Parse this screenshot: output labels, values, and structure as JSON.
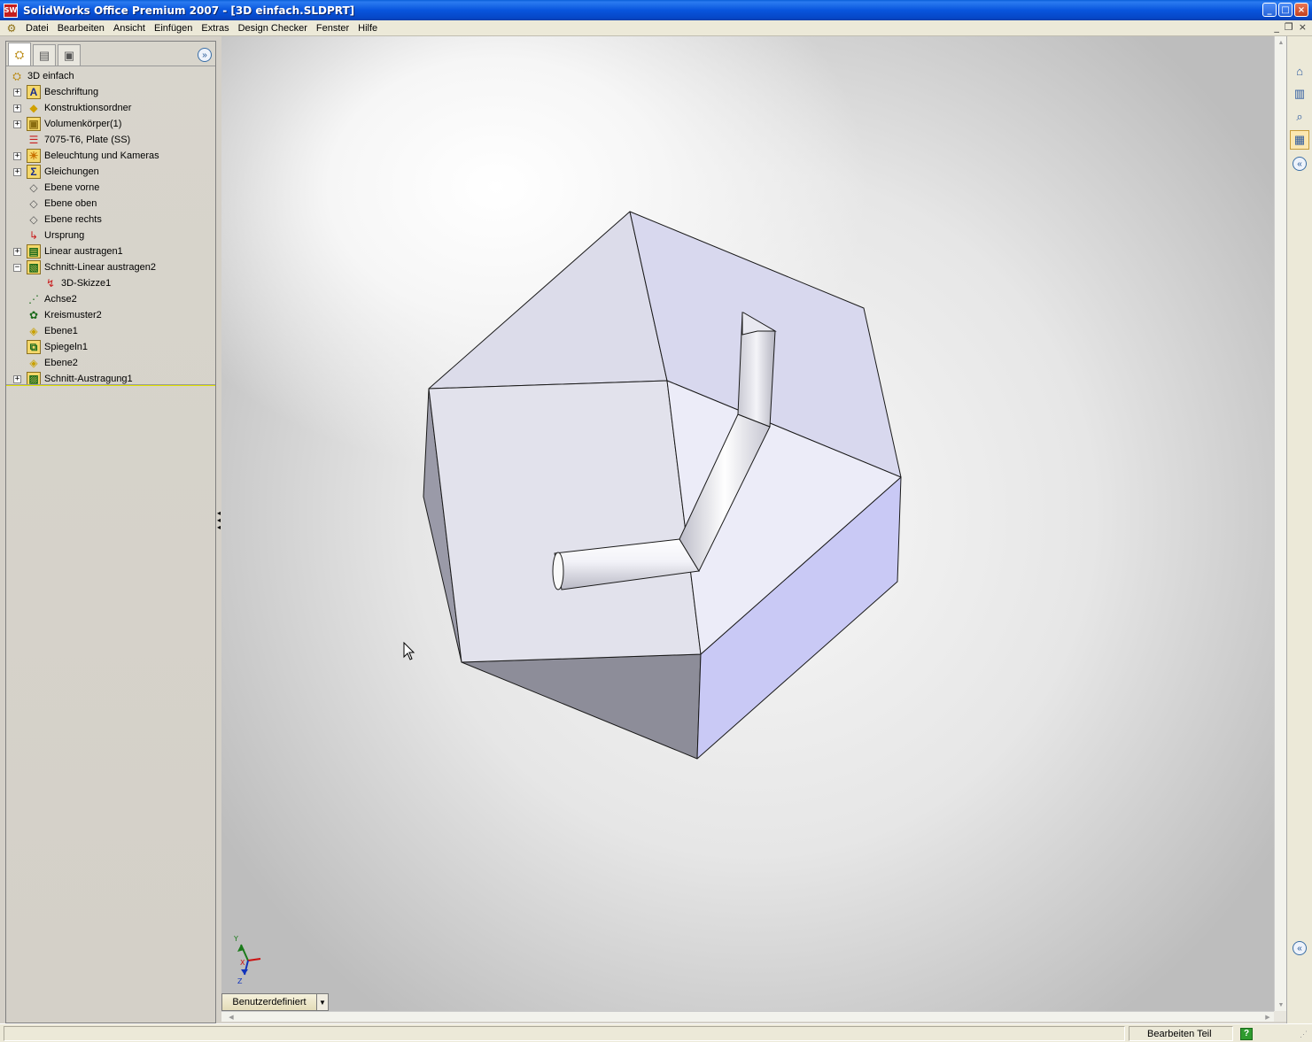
{
  "window": {
    "title": "SolidWorks Office Premium 2007 - [3D einfach.SLDPRT]",
    "app_icon_text": "SW",
    "controls": [
      "_",
      "□",
      "×"
    ],
    "mdi_controls": [
      "_",
      "❐",
      "×"
    ]
  },
  "menu": {
    "items": [
      "Datei",
      "Bearbeiten",
      "Ansicht",
      "Einfügen",
      "Extras",
      "Design Checker",
      "Fenster",
      "Hilfe"
    ]
  },
  "feature_tree": {
    "root": "3D einfach",
    "items": [
      {
        "label": "Beschriftung",
        "icon": "annotations-icon",
        "expander": "+",
        "indent": 0
      },
      {
        "label": "Konstruktionsordner",
        "icon": "design-binder-icon",
        "expander": "+",
        "indent": 0
      },
      {
        "label": "Volumenkörper(1)",
        "icon": "solid-bodies-icon",
        "expander": "+",
        "indent": 0
      },
      {
        "label": "7075-T6, Plate (SS)",
        "icon": "material-icon",
        "expander": "",
        "indent": 0
      },
      {
        "label": "Beleuchtung und Kameras",
        "icon": "lights-cameras-icon",
        "expander": "+",
        "indent": 0
      },
      {
        "label": "Gleichungen",
        "icon": "equations-icon",
        "expander": "+",
        "indent": 0
      },
      {
        "label": "Ebene vorne",
        "icon": "plane-icon",
        "expander": "",
        "indent": 0
      },
      {
        "label": "Ebene oben",
        "icon": "plane-icon",
        "expander": "",
        "indent": 0
      },
      {
        "label": "Ebene rechts",
        "icon": "plane-icon",
        "expander": "",
        "indent": 0
      },
      {
        "label": "Ursprung",
        "icon": "origin-icon",
        "expander": "",
        "indent": 0
      },
      {
        "label": "Linear austragen1",
        "icon": "extrude-icon",
        "expander": "+",
        "indent": 0
      },
      {
        "label": "Schnitt-Linear austragen2",
        "icon": "cut-extrude-icon",
        "expander": "−",
        "indent": 0
      },
      {
        "label": "3D-Skizze1",
        "icon": "3d-sketch-icon",
        "expander": "",
        "indent": 1
      },
      {
        "label": "Achse2",
        "icon": "axis-icon",
        "expander": "",
        "indent": 0
      },
      {
        "label": "Kreismuster2",
        "icon": "circular-pattern-icon",
        "expander": "",
        "indent": 0
      },
      {
        "label": "Ebene1",
        "icon": "ref-plane-icon",
        "expander": "",
        "indent": 0
      },
      {
        "label": "Spiegeln1",
        "icon": "mirror-icon",
        "expander": "",
        "indent": 0
      },
      {
        "label": "Ebene2",
        "icon": "ref-plane-icon",
        "expander": "",
        "indent": 0
      },
      {
        "label": "Schnitt-Austragung1",
        "icon": "cut-sweep-icon",
        "expander": "+",
        "indent": 0
      }
    ]
  },
  "viewport": {
    "view_orientation": "Benutzerdefiniert",
    "triad_labels": {
      "y": "Y",
      "x": "X",
      "z": "Z"
    }
  },
  "status": {
    "mode": "Bearbeiten Teil",
    "help": "?"
  },
  "colors": {
    "titlebar": "#0855dd",
    "face_top": "#dcdcec",
    "face_side": "#c9c9f5",
    "face_dark": "#8d8d99"
  }
}
